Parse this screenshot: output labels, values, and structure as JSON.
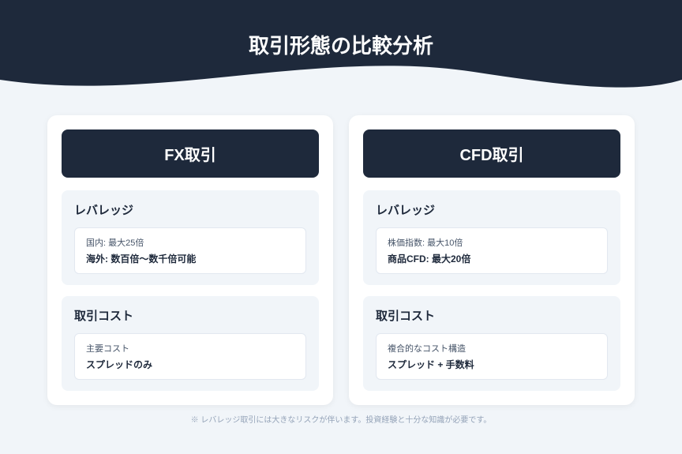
{
  "header": {
    "title": "取引形態の比較分析"
  },
  "cards": [
    {
      "title": "FX取引",
      "sections": [
        {
          "title": "レバレッジ",
          "sub": "国内: 最大25倍",
          "val": "海外: 数百倍～数千倍可能"
        },
        {
          "title": "取引コスト",
          "sub": "主要コスト",
          "val": "スプレッドのみ"
        }
      ]
    },
    {
      "title": "CFD取引",
      "sections": [
        {
          "title": "レバレッジ",
          "sub": "株価指数: 最大10倍",
          "val": "商品CFD: 最大20倍"
        },
        {
          "title": "取引コスト",
          "sub": "複合的なコスト構造",
          "val": "スプレッド + 手数料"
        }
      ]
    }
  ],
  "footnote": "※ レバレッジ取引には大きなリスクが伴います。投資経験と十分な知識が必要です。"
}
